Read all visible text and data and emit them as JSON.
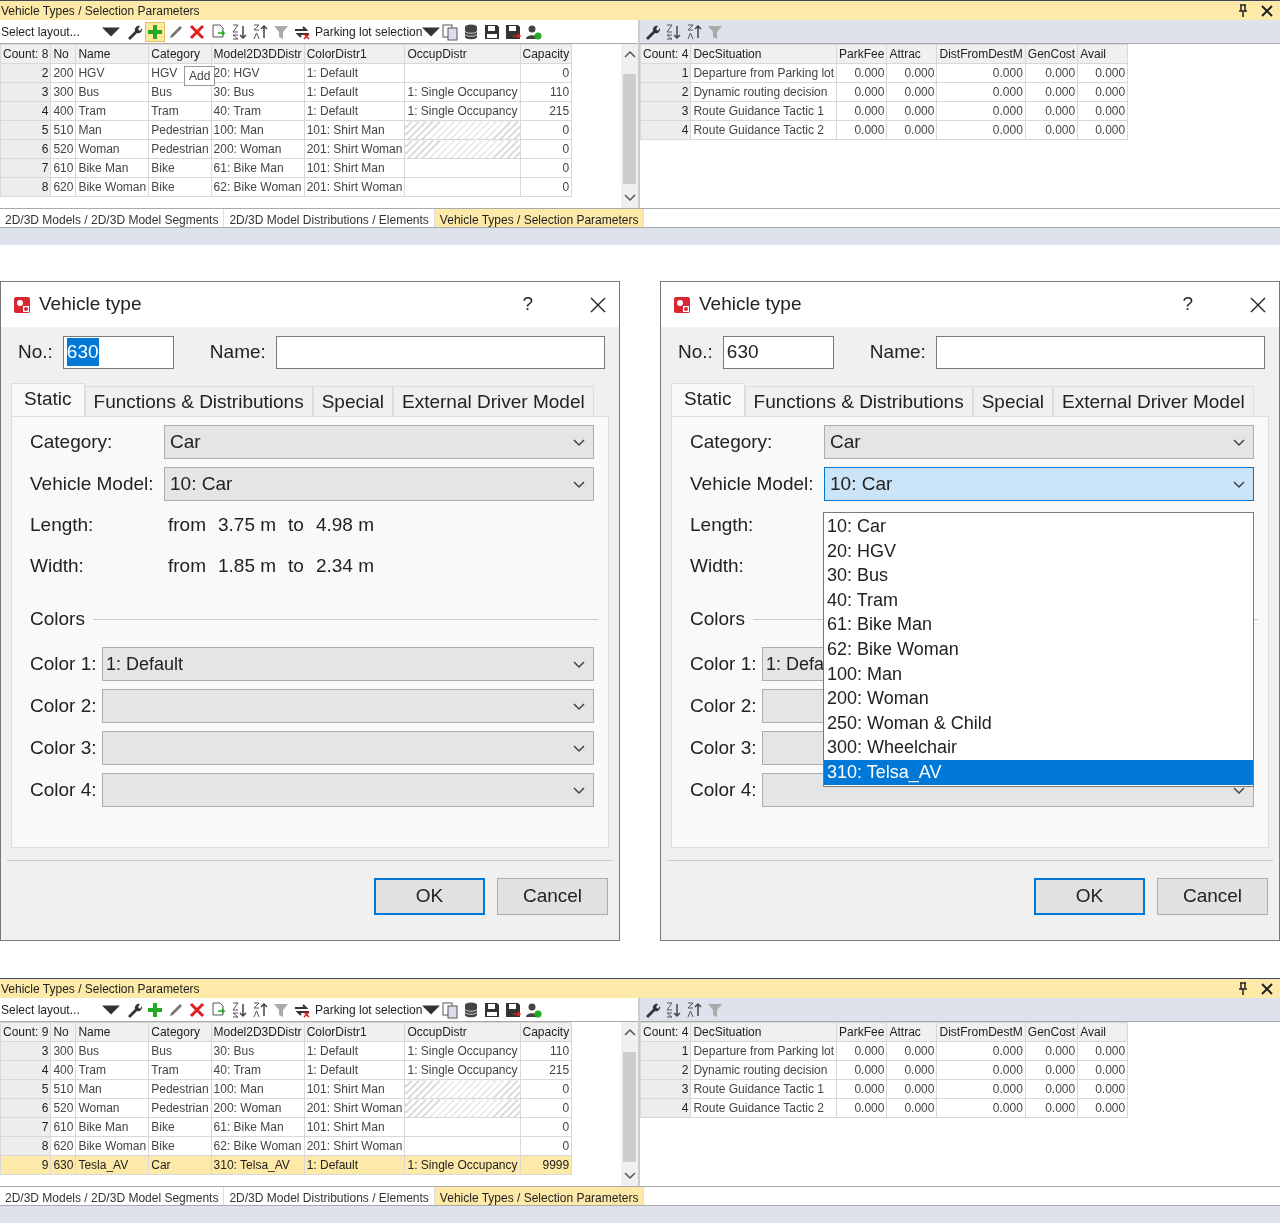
{
  "panels": [
    {
      "title": "Vehicle Types / Selection Parameters",
      "layout_select": "Select layout...",
      "selection_select": "Parking lot selection",
      "add_highlighted": true,
      "tooltip": "Add",
      "grid": {
        "columns": [
          "Count: 8",
          "No",
          "Name",
          "Category",
          "Model2D3DDistr",
          "ColorDistr1",
          "OccupDistr",
          "Capacity"
        ],
        "rows": [
          {
            "cells": [
              "2",
              "200",
              "HGV",
              "HGV",
              "20: HGV",
              "1: Default",
              null,
              "0"
            ],
            "hatched": false,
            "selected": false
          },
          {
            "cells": [
              "3",
              "300",
              "Bus",
              "Bus",
              "30: Bus",
              "1: Default",
              "1: Single Occupancy",
              "110"
            ],
            "hatched": false,
            "selected": false
          },
          {
            "cells": [
              "4",
              "400",
              "Tram",
              "Tram",
              "40: Tram",
              "1: Default",
              "1: Single Occupancy",
              "215"
            ],
            "hatched": false,
            "selected": false
          },
          {
            "cells": [
              "5",
              "510",
              "Man",
              "Pedestrian",
              "100: Man",
              "101: Shirt Man",
              null,
              "0"
            ],
            "hatched": true,
            "selected": false
          },
          {
            "cells": [
              "6",
              "520",
              "Woman",
              "Pedestrian",
              "200: Woman",
              "201: Shirt Woman",
              null,
              "0"
            ],
            "hatched": true,
            "selected": false
          },
          {
            "cells": [
              "7",
              "610",
              "Bike Man",
              "Bike",
              "61: Bike Man",
              "101: Shirt Man",
              null,
              "0"
            ],
            "hatched": false,
            "selected": false
          },
          {
            "cells": [
              "8",
              "620",
              "Bike Woman",
              "Bike",
              "62: Bike Woman",
              "201: Shirt Woman",
              null,
              "0"
            ],
            "hatched": false,
            "selected": false
          }
        ]
      },
      "decisions": {
        "columns": [
          "Count: 4",
          "DecSituation",
          "ParkFee",
          "Attrac",
          "DistFromDestM",
          "GenCost",
          "Avail"
        ],
        "rows": [
          {
            "cells": [
              "1",
              "Departure from Parking lot",
              "0.000",
              "0.000",
              "0.000",
              "0.000",
              "0.000"
            ]
          },
          {
            "cells": [
              "2",
              "Dynamic routing decision",
              "0.000",
              "0.000",
              "0.000",
              "0.000",
              "0.000"
            ]
          },
          {
            "cells": [
              "3",
              "Route Guidance Tactic 1",
              "0.000",
              "0.000",
              "0.000",
              "0.000",
              "0.000"
            ]
          },
          {
            "cells": [
              "4",
              "Route Guidance Tactic 2",
              "0.000",
              "0.000",
              "0.000",
              "0.000",
              "0.000"
            ]
          }
        ]
      },
      "tabs": [
        {
          "label": "2D/3D Models / 2D/3D Model Segments",
          "selected": false
        },
        {
          "label": "2D/3D Model Distributions / Elements",
          "selected": false
        },
        {
          "label": "Vehicle Types / Selection Parameters",
          "selected": true
        }
      ]
    },
    {
      "title": "Vehicle Types / Selection Parameters",
      "layout_select": "Select layout...",
      "selection_select": "Parking lot selection",
      "add_highlighted": false,
      "grid": {
        "columns": [
          "Count: 9",
          "No",
          "Name",
          "Category",
          "Model2D3DDistr",
          "ColorDistr1",
          "OccupDistr",
          "Capacity"
        ],
        "rows": [
          {
            "cells": [
              "3",
              "300",
              "Bus",
              "Bus",
              "30: Bus",
              "1: Default",
              "1: Single Occupancy",
              "110"
            ],
            "hatched": false,
            "selected": false
          },
          {
            "cells": [
              "4",
              "400",
              "Tram",
              "Tram",
              "40: Tram",
              "1: Default",
              "1: Single Occupancy",
              "215"
            ],
            "hatched": false,
            "selected": false
          },
          {
            "cells": [
              "5",
              "510",
              "Man",
              "Pedestrian",
              "100: Man",
              "101: Shirt Man",
              null,
              "0"
            ],
            "hatched": true,
            "selected": false
          },
          {
            "cells": [
              "6",
              "520",
              "Woman",
              "Pedestrian",
              "200: Woman",
              "201: Shirt Woman",
              null,
              "0"
            ],
            "hatched": true,
            "selected": false
          },
          {
            "cells": [
              "7",
              "610",
              "Bike Man",
              "Bike",
              "61: Bike Man",
              "101: Shirt Man",
              null,
              "0"
            ],
            "hatched": false,
            "selected": false
          },
          {
            "cells": [
              "8",
              "620",
              "Bike Woman",
              "Bike",
              "62: Bike Woman",
              "201: Shirt Woman",
              null,
              "0"
            ],
            "hatched": false,
            "selected": false
          },
          {
            "cells": [
              "9",
              "630",
              "Tesla_AV",
              "Car",
              "310: Telsa_AV",
              "1: Default",
              "1: Single Occupancy",
              "9999"
            ],
            "hatched": false,
            "selected": true
          }
        ]
      },
      "decisions": {
        "columns": [
          "Count: 4",
          "DecSituation",
          "ParkFee",
          "Attrac",
          "DistFromDestM",
          "GenCost",
          "Avail"
        ],
        "rows": [
          {
            "cells": [
              "1",
              "Departure from Parking lot",
              "0.000",
              "0.000",
              "0.000",
              "0.000",
              "0.000"
            ]
          },
          {
            "cells": [
              "2",
              "Dynamic routing decision",
              "0.000",
              "0.000",
              "0.000",
              "0.000",
              "0.000"
            ]
          },
          {
            "cells": [
              "3",
              "Route Guidance Tactic 1",
              "0.000",
              "0.000",
              "0.000",
              "0.000",
              "0.000"
            ]
          },
          {
            "cells": [
              "4",
              "Route Guidance Tactic 2",
              "0.000",
              "0.000",
              "0.000",
              "0.000",
              "0.000"
            ]
          }
        ]
      },
      "tabs": [
        {
          "label": "2D/3D Models / 2D/3D Model Segments",
          "selected": false
        },
        {
          "label": "2D/3D Model Distributions / Elements",
          "selected": false
        },
        {
          "label": "Vehicle Types / Selection Parameters",
          "selected": true
        }
      ]
    }
  ],
  "dialogs": [
    {
      "title": "Vehicle type",
      "help": "?",
      "number_label": "No.:",
      "number": "630",
      "number_selected": true,
      "name_label": "Name:",
      "tabs": [
        {
          "label": "Static",
          "selected": true
        },
        {
          "label": "Functions & Distributions",
          "selected": false
        },
        {
          "label": "Special",
          "selected": false
        },
        {
          "label": "External Driver Model",
          "selected": false
        }
      ],
      "fields": [
        {
          "label": "Category:",
          "value": "Car",
          "focused": false
        },
        {
          "label": "Vehicle Model:",
          "value": "10: Car",
          "focused": false
        }
      ],
      "dims": [
        {
          "label": "Length:",
          "from_label": "from",
          "from": "3.75 m",
          "to_label": "to",
          "to": "4.98 m"
        },
        {
          "label": "Width:",
          "from_label": "from",
          "from": "1.85 m",
          "to_label": "to",
          "to": "2.34 m"
        }
      ],
      "colors_label": "Colors",
      "colors": [
        {
          "label": "Color 1:",
          "value": "1: Default"
        },
        {
          "label": "Color 2:"
        },
        {
          "label": "Color 3:"
        },
        {
          "label": "Color 4:"
        }
      ],
      "ok": "OK",
      "cancel": "Cancel"
    },
    {
      "title": "Vehicle type",
      "help": "?",
      "number_label": "No.:",
      "number": "630",
      "number_selected": false,
      "name_label": "Name:",
      "tabs": [
        {
          "label": "Static",
          "selected": true
        },
        {
          "label": "Functions & Distributions",
          "selected": false
        },
        {
          "label": "Special",
          "selected": false
        },
        {
          "label": "External Driver Model",
          "selected": false
        }
      ],
      "fields": [
        {
          "label": "Category:",
          "value": "Car",
          "focused": false
        },
        {
          "label": "Vehicle Model:",
          "value": "10: Car",
          "focused": true
        }
      ],
      "dims": [
        {
          "label": "Length:"
        },
        {
          "label": "Width:"
        }
      ],
      "colors_label": "Colors",
      "colors": [
        {
          "label": "Color 1:",
          "value": "1: Defa"
        },
        {
          "label": "Color 2:"
        },
        {
          "label": "Color 3:"
        },
        {
          "label": "Color 4:"
        }
      ],
      "ok": "OK",
      "cancel": "Cancel",
      "dropdown": {
        "items": [
          {
            "label": "10: Car",
            "selected": false
          },
          {
            "label": "20: HGV",
            "selected": false
          },
          {
            "label": "30: Bus",
            "selected": false
          },
          {
            "label": "40: Tram",
            "selected": false
          },
          {
            "label": "61: Bike Man",
            "selected": false
          },
          {
            "label": "62: Bike Woman",
            "selected": false
          },
          {
            "label": "100: Man",
            "selected": false
          },
          {
            "label": "200: Woman",
            "selected": false
          },
          {
            "label": "250: Woman & Child",
            "selected": false
          },
          {
            "label": "300: Wheelchair",
            "selected": false
          },
          {
            "label": "310: Telsa_AV",
            "selected": true
          }
        ]
      }
    }
  ]
}
